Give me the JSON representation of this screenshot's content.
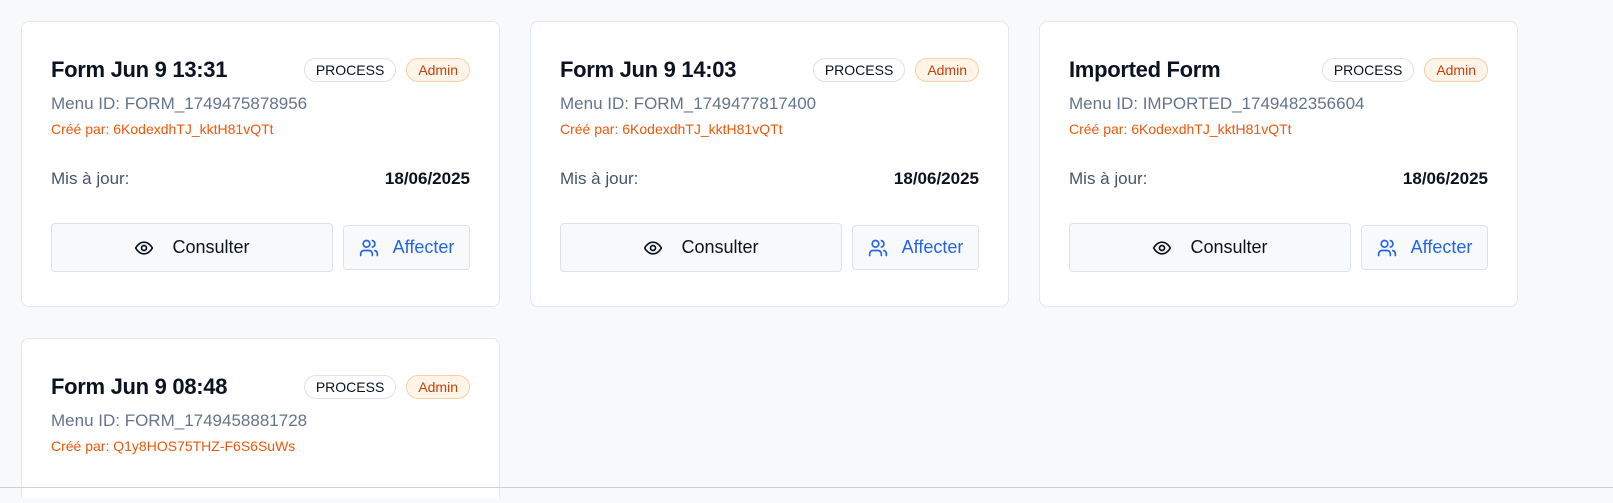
{
  "cards": [
    {
      "title": "Form Jun 9 13:31",
      "type_badge": "PROCESS",
      "role_badge": "Admin",
      "menu_id": "Menu ID: FORM_1749475878956",
      "created_by": "Créé par: 6KodexdhTJ_kktH81vQTt",
      "updated_label": "Mis à jour:",
      "updated_value": "18/06/2025",
      "view_label": "Consulter",
      "assign_label": "Affecter"
    },
    {
      "title": "Form Jun 9 14:03",
      "type_badge": "PROCESS",
      "role_badge": "Admin",
      "menu_id": "Menu ID: FORM_1749477817400",
      "created_by": "Créé par: 6KodexdhTJ_kktH81vQTt",
      "updated_label": "Mis à jour:",
      "updated_value": "18/06/2025",
      "view_label": "Consulter",
      "assign_label": "Affecter"
    },
    {
      "title": "Imported Form",
      "type_badge": "PROCESS",
      "role_badge": "Admin",
      "menu_id": "Menu ID: IMPORTED_1749482356604",
      "created_by": "Créé par: 6KodexdhTJ_kktH81vQTt",
      "updated_label": "Mis à jour:",
      "updated_value": "18/06/2025",
      "view_label": "Consulter",
      "assign_label": "Affecter"
    },
    {
      "title": "Form Jun 9 08:48",
      "type_badge": "PROCESS",
      "role_badge": "Admin",
      "menu_id": "Menu ID: FORM_1749458881728",
      "created_by": "Créé par: Q1y8HOS75THZ-F6S6SuWs"
    }
  ],
  "icons": {
    "view": "eye-icon",
    "assign": "users-icon"
  },
  "colors": {
    "role_badge_text": "#c2410c",
    "creator_text": "#ea580c",
    "assign_text": "#2563eb"
  }
}
